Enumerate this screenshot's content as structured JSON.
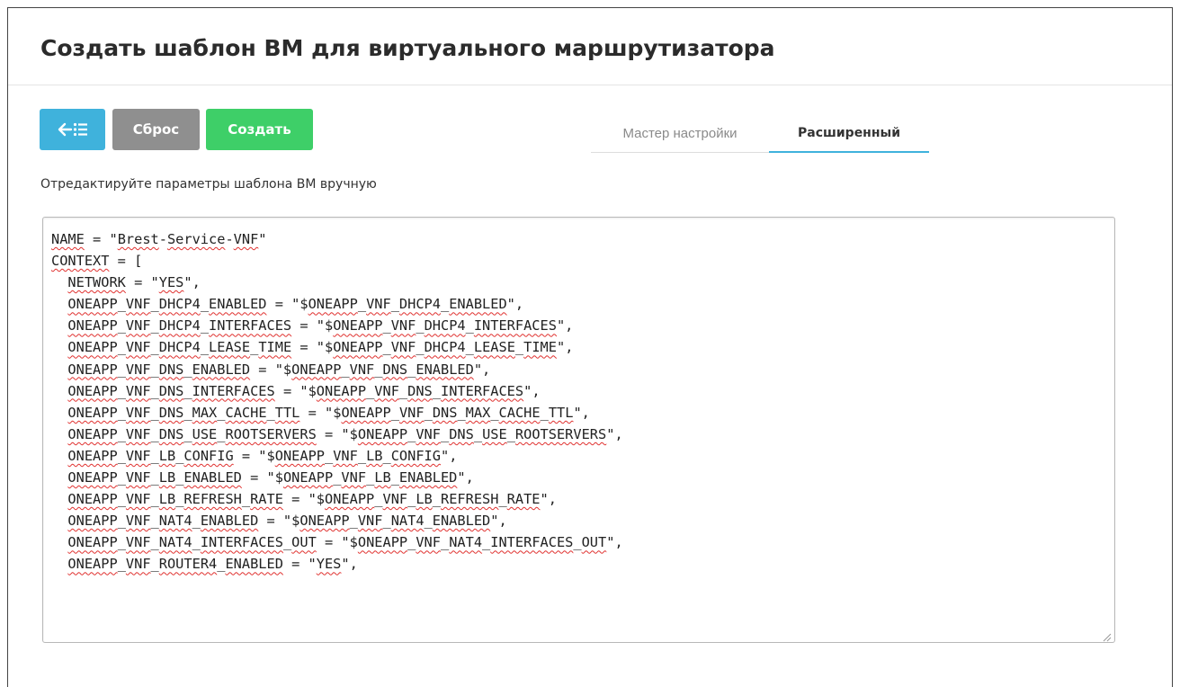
{
  "title": "Создать шаблон ВМ для виртуального маршрутизатора",
  "toolbar": {
    "back_icon": "arrow-left-list-icon",
    "reset_label": "Сброс",
    "create_label": "Создать"
  },
  "tabs": {
    "wizard_label": "Мастер настройки",
    "advanced_label": "Расширенный",
    "active": "advanced"
  },
  "hint": "Отредактируйте параметры шаблона ВМ вручную",
  "editor": {
    "lines": [
      "NAME = \"Brest-Service-VNF\"",
      "CONTEXT = [",
      "  NETWORK = \"YES\",",
      "  ONEAPP_VNF_DHCP4_ENABLED = \"$ONEAPP_VNF_DHCP4_ENABLED\",",
      "  ONEAPP_VNF_DHCP4_INTERFACES = \"$ONEAPP_VNF_DHCP4_INTERFACES\",",
      "  ONEAPP_VNF_DHCP4_LEASE_TIME = \"$ONEAPP_VNF_DHCP4_LEASE_TIME\",",
      "  ONEAPP_VNF_DNS_ENABLED = \"$ONEAPP_VNF_DNS_ENABLED\",",
      "  ONEAPP_VNF_DNS_INTERFACES = \"$ONEAPP_VNF_DNS_INTERFACES\",",
      "  ONEAPP_VNF_DNS_MAX_CACHE_TTL = \"$ONEAPP_VNF_DNS_MAX_CACHE_TTL\",",
      "  ONEAPP_VNF_DNS_USE_ROOTSERVERS = \"$ONEAPP_VNF_DNS_USE_ROOTSERVERS\",",
      "  ONEAPP_VNF_LB_CONFIG = \"$ONEAPP_VNF_LB_CONFIG\",",
      "  ONEAPP_VNF_LB_ENABLED = \"$ONEAPP_VNF_LB_ENABLED\",",
      "  ONEAPP_VNF_LB_REFRESH_RATE = \"$ONEAPP_VNF_LB_REFRESH_RATE\",",
      "  ONEAPP_VNF_NAT4_ENABLED = \"$ONEAPP_VNF_NAT4_ENABLED\",",
      "  ONEAPP_VNF_NAT4_INTERFACES_OUT = \"$ONEAPP_VNF_NAT4_INTERFACES_OUT\",",
      "  ONEAPP_VNF_ROUTER4_ENABLED = \"YES\","
    ]
  },
  "colors": {
    "back_button": "#3fb2dc",
    "reset_button": "#8f8f8f",
    "create_button": "#3ecf68",
    "active_tab_underline": "#3fb2dc",
    "spellcheck_underline": "#e0312f"
  }
}
